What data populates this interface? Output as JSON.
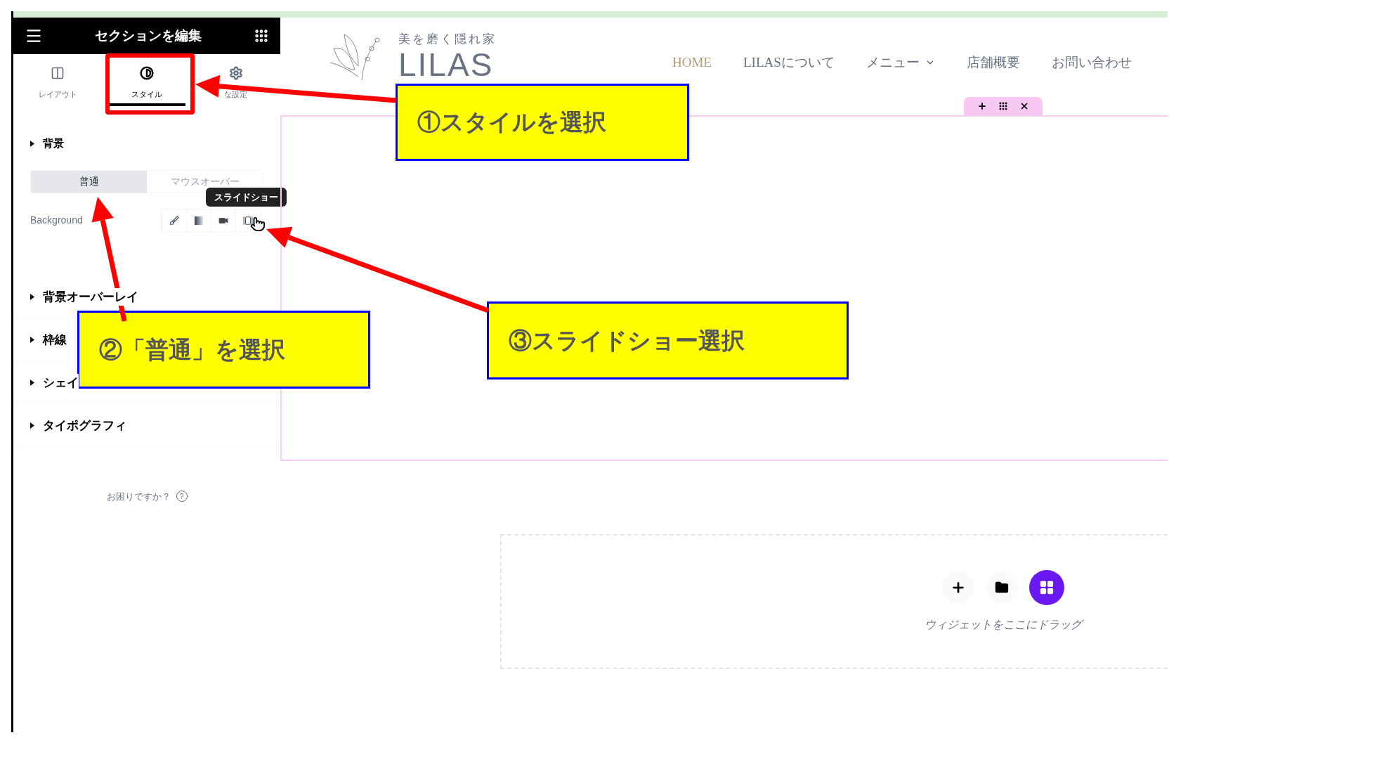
{
  "editor_panel": {
    "title": "セクションを編集",
    "tabs": [
      {
        "label": "レイアウト",
        "selected": false,
        "kind": "layout"
      },
      {
        "label": "スタイル",
        "selected": true,
        "kind": "style"
      },
      {
        "label": "な設定",
        "selected": false,
        "kind": "advanced"
      }
    ],
    "background": {
      "title": "背景",
      "state_tabs": [
        {
          "label": "普通",
          "selected": true
        },
        {
          "label": "マウスオーバー",
          "selected": false
        }
      ],
      "type_label": "Background",
      "type_options": [
        {
          "kind": "classic"
        },
        {
          "kind": "gradient"
        },
        {
          "kind": "video"
        },
        {
          "kind": "slideshow"
        }
      ],
      "tooltip": "スライドショー"
    },
    "sections": [
      {
        "title": "背景オーバーレイ"
      },
      {
        "title": "枠線"
      },
      {
        "title": "シェイ"
      },
      {
        "title": "タイポグラフィ"
      }
    ],
    "help": "お困りですか？",
    "help_icon": "?"
  },
  "site": {
    "tagline": "美を磨く隠れ家",
    "logo": "LILAS",
    "nav": [
      {
        "label": "HOME",
        "selected": true,
        "kind": "link"
      },
      {
        "label": "LILASについて",
        "selected": false,
        "kind": "link"
      },
      {
        "label": "メニュー",
        "selected": false,
        "kind": "dropdown"
      },
      {
        "label": "店舗概要",
        "selected": false,
        "kind": "link"
      },
      {
        "label": "お問い合わせ",
        "selected": false,
        "kind": "link"
      }
    ]
  },
  "drop_zone": {
    "text": "ウィジェットをここにドラッグ"
  },
  "annotations": [
    {
      "text": "①スタイルを選択"
    },
    {
      "text": "②「普通」を選択"
    },
    {
      "text": "③スライドショー選択"
    }
  ]
}
